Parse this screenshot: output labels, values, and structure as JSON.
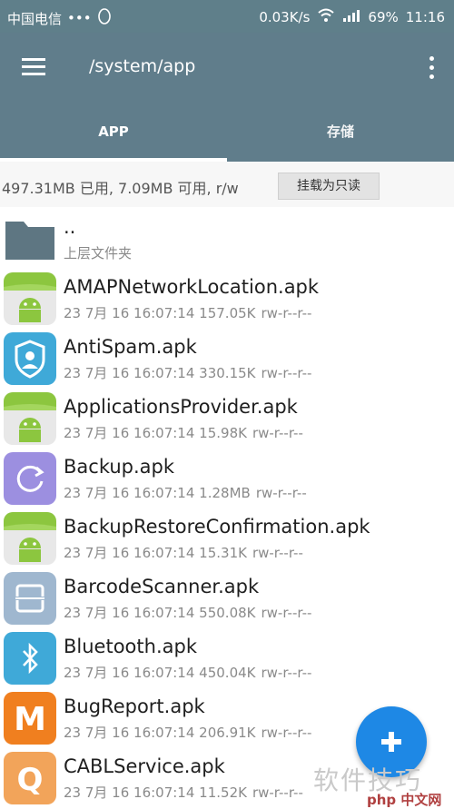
{
  "status_bar": {
    "carrier": "中国电信",
    "dots": "•••",
    "speed": "0.03K/s",
    "battery": "69%",
    "time": "11:16"
  },
  "toolbar": {
    "path": "/system/app",
    "menu_icon": "hamburger-menu-icon",
    "overflow_icon": "more-vert-icon"
  },
  "tabs": [
    {
      "label": "APP",
      "active": true
    },
    {
      "label": "存储",
      "active": false
    }
  ],
  "storage": {
    "usage": "497.31MB 已用, 7.09MB 可用, r/w",
    "readonly_button": "挂载为只读"
  },
  "parent_dir": {
    "name": "..",
    "subtitle": "上层文件夹"
  },
  "files": [
    {
      "name": "AMAPNetworkLocation.apk",
      "date": "23 7月 16 16:07:14",
      "size": "157.05K",
      "perm": "rw-r--r--",
      "icon": "android"
    },
    {
      "name": "AntiSpam.apk",
      "date": "23 7月 16 16:07:14",
      "size": "330.15K",
      "perm": "rw-r--r--",
      "icon": "shield"
    },
    {
      "name": "ApplicationsProvider.apk",
      "date": "23 7月 16 16:07:14",
      "size": "15.98K",
      "perm": "rw-r--r--",
      "icon": "android"
    },
    {
      "name": "Backup.apk",
      "date": "23 7月 16 16:07:14",
      "size": "1.28MB",
      "perm": "rw-r--r--",
      "icon": "backup"
    },
    {
      "name": "BackupRestoreConfirmation.apk",
      "date": "23 7月 16 16:07:14",
      "size": "15.31K",
      "perm": "rw-r--r--",
      "icon": "android"
    },
    {
      "name": "BarcodeScanner.apk",
      "date": "23 7月 16 16:07:14",
      "size": "550.08K",
      "perm": "rw-r--r--",
      "icon": "barcode"
    },
    {
      "name": "Bluetooth.apk",
      "date": "23 7月 16 16:07:14",
      "size": "450.04K",
      "perm": "rw-r--r--",
      "icon": "bluetooth"
    },
    {
      "name": "BugReport.apk",
      "date": "23 7月 16 16:07:14",
      "size": "206.91K",
      "perm": "rw-r--r--",
      "icon": "bugreport",
      "letter": "M"
    },
    {
      "name": "CABLService.apk",
      "date": "23 7月 16 16:07:14",
      "size": "11.52K",
      "perm": "rw-r--r--",
      "icon": "cabl",
      "letter": "Q"
    }
  ],
  "watermark": {
    "text": "软件技巧",
    "site": "php 中文网"
  },
  "colors": {
    "toolbar": "#607d8b",
    "fab": "#1e88e5"
  }
}
